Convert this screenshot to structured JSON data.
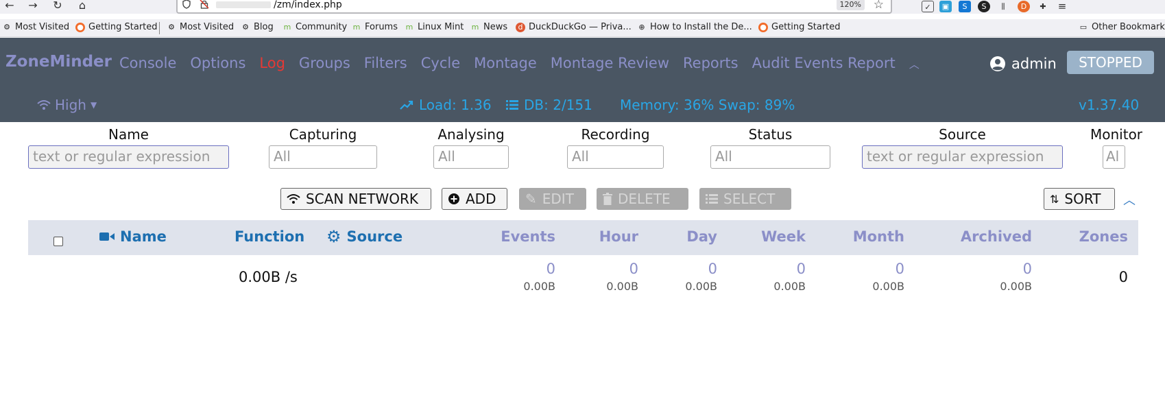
{
  "browser": {
    "url": "/zm/index.php",
    "zoom": "120%",
    "bookmarks": [
      {
        "label": "Most Visited"
      },
      {
        "label": "Getting Started"
      },
      {
        "label": "Most Visited"
      },
      {
        "label": "Blog"
      },
      {
        "label": "Community"
      },
      {
        "label": "Forums"
      },
      {
        "label": "Linux Mint"
      },
      {
        "label": "News"
      },
      {
        "label": "DuckDuckGo — Priva..."
      },
      {
        "label": "How to Install the De..."
      },
      {
        "label": "Getting Started"
      }
    ],
    "other_bookmarks": "Other Bookmarks"
  },
  "header": {
    "brand": "ZoneMinder",
    "nav": [
      "Console",
      "Options",
      "Log",
      "Groups",
      "Filters",
      "Cycle",
      "Montage",
      "Montage Review",
      "Reports",
      "Audit Events Report"
    ],
    "active_nav": "Log",
    "user": "admin",
    "state": "STOPPED"
  },
  "status": {
    "bandwidth": "High",
    "load": "Load: 1.36",
    "db": "DB: 2/151",
    "memory": "Memory: 36% Swap: 89%",
    "version": "v1.37.40"
  },
  "filters": {
    "name": {
      "label": "Name",
      "placeholder": "text or regular expression"
    },
    "capturing": {
      "label": "Capturing",
      "placeholder": "All"
    },
    "analysing": {
      "label": "Analysing",
      "placeholder": "All"
    },
    "recording": {
      "label": "Recording",
      "placeholder": "All"
    },
    "status": {
      "label": "Status",
      "placeholder": "All"
    },
    "source": {
      "label": "Source",
      "placeholder": "text or regular expression"
    },
    "monitor": {
      "label": "Monitor",
      "placeholder": "Al"
    }
  },
  "toolbar": {
    "scan": "SCAN NETWORK",
    "add": "ADD",
    "edit": "EDIT",
    "delete": "DELETE",
    "select": "SELECT",
    "sort": "SORT"
  },
  "table": {
    "headers": {
      "name": "Name",
      "function": "Function",
      "source": "Source",
      "events": "Events",
      "hour": "Hour",
      "day": "Day",
      "week": "Week",
      "month": "Month",
      "archived": "Archived",
      "zones": "Zones"
    },
    "totals": {
      "function": "0.00B /s",
      "events": {
        "count": "0",
        "size": "0.00B"
      },
      "hour": {
        "count": "0",
        "size": "0.00B"
      },
      "day": {
        "count": "0",
        "size": "0.00B"
      },
      "week": {
        "count": "0",
        "size": "0.00B"
      },
      "month": {
        "count": "0",
        "size": "0.00B"
      },
      "archived": {
        "count": "0",
        "size": "0.00B"
      },
      "zones": "0"
    }
  }
}
